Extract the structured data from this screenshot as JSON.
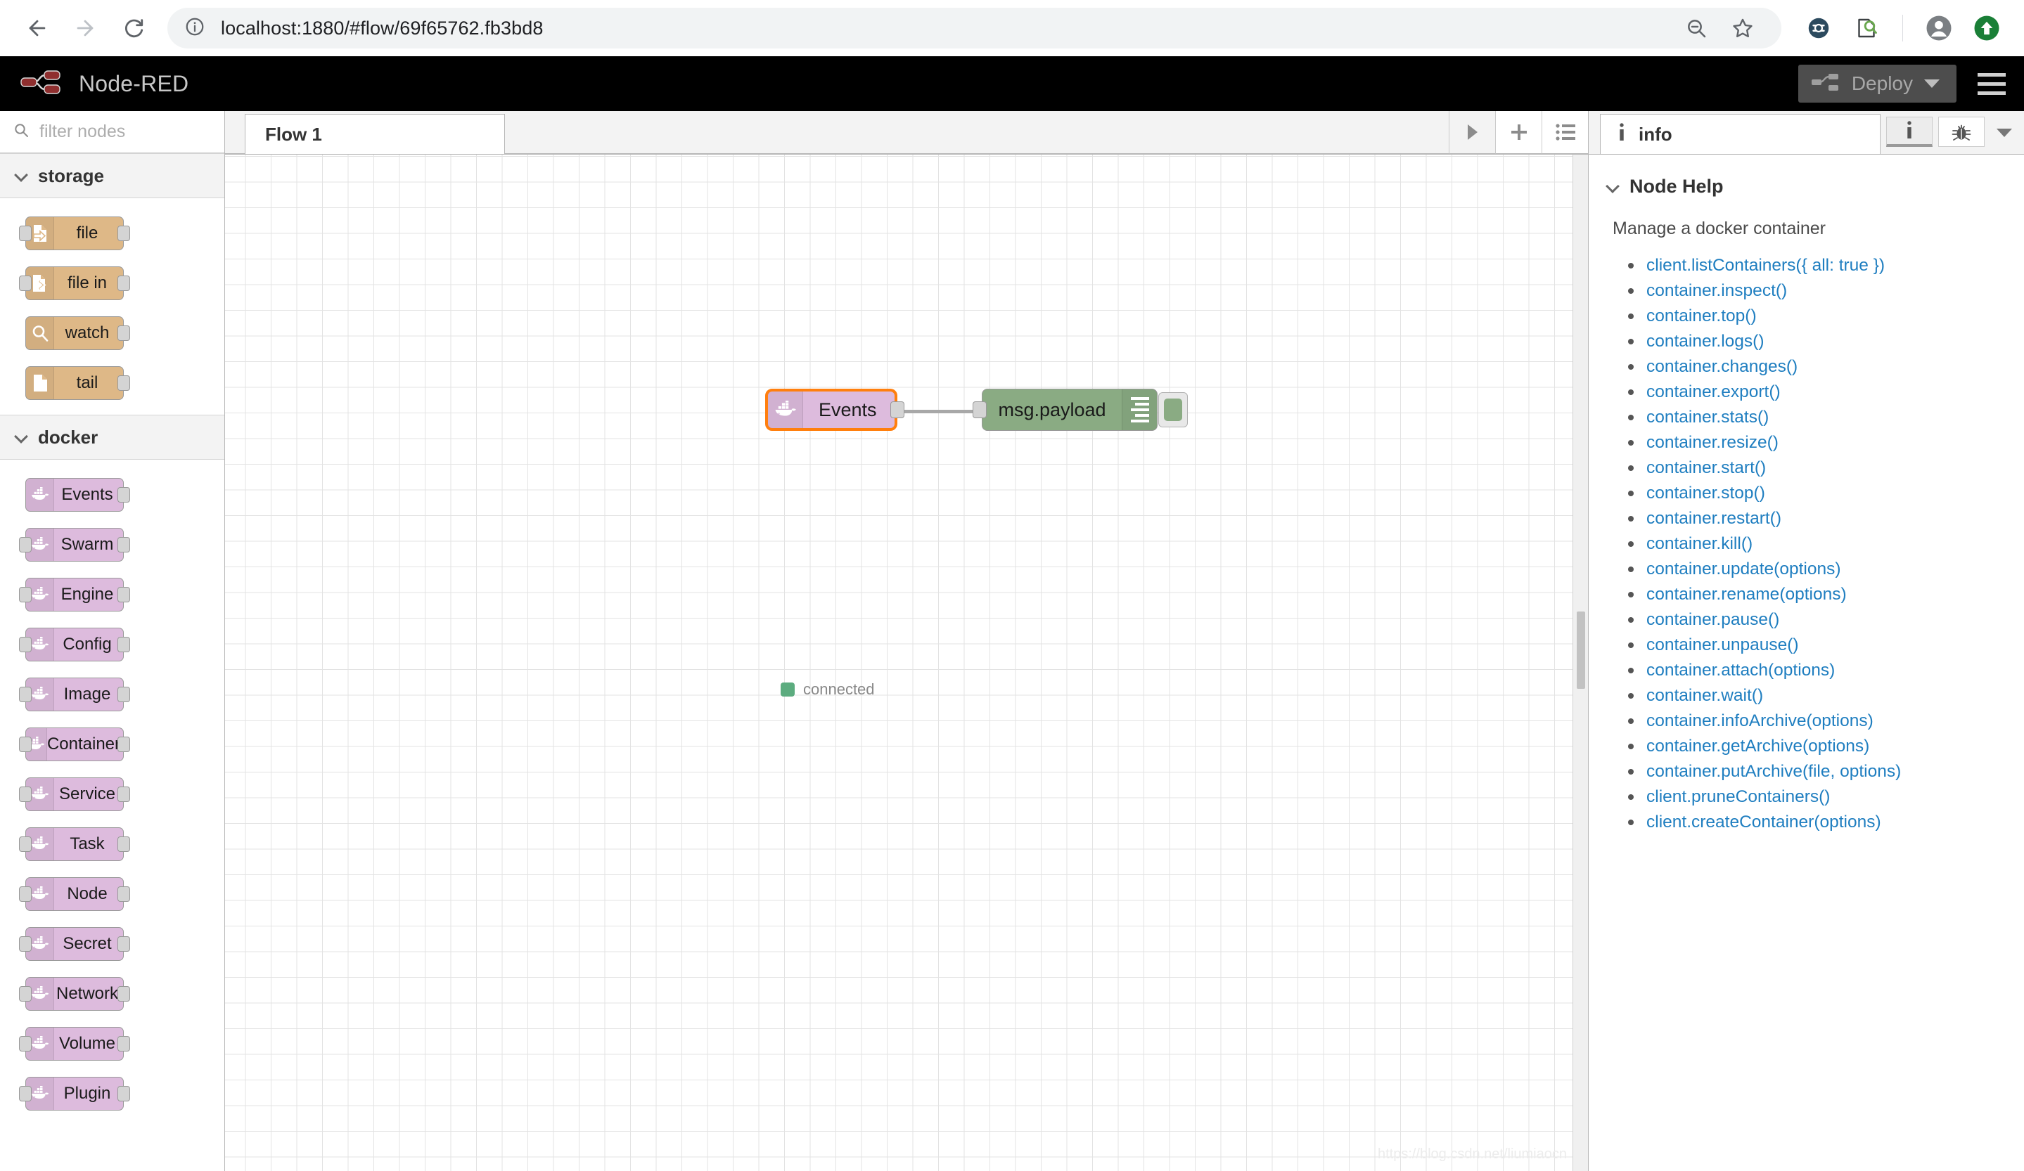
{
  "browser": {
    "url": "localhost:1880/#flow/69f65762.fb3bd8",
    "back_label": "Back",
    "forward_label": "Forward",
    "reload_label": "Reload",
    "site_info_label": "Site information",
    "zoom_out_label": "Zoom out",
    "bookmark_label": "Bookmark this tab",
    "extension1_label": "Extension",
    "extension2_label": "Extension",
    "profile_label": "Profile",
    "update_label": "Update"
  },
  "header": {
    "title": "Node-RED",
    "deploy_label": "Deploy",
    "menu_label": "Main menu"
  },
  "palette": {
    "search_placeholder": "filter nodes",
    "categories": [
      {
        "name": "storage",
        "color": "#deb887",
        "nodes": [
          {
            "label": "file",
            "icon": "file-export-icon",
            "inputs": 1,
            "outputs": 1
          },
          {
            "label": "file in",
            "icon": "file-in-icon",
            "inputs": 1,
            "outputs": 1
          },
          {
            "label": "watch",
            "icon": "magnifier-icon",
            "inputs": 0,
            "outputs": 1
          },
          {
            "label": "tail",
            "icon": "document-icon",
            "inputs": 0,
            "outputs": 1
          }
        ]
      },
      {
        "name": "docker",
        "color": "#ddbbdd",
        "nodes": [
          {
            "label": "Events",
            "icon": "docker-whale-icon",
            "inputs": 0,
            "outputs": 1
          },
          {
            "label": "Swarm",
            "icon": "docker-whale-icon",
            "inputs": 1,
            "outputs": 1
          },
          {
            "label": "Engine",
            "icon": "docker-whale-icon",
            "inputs": 1,
            "outputs": 1
          },
          {
            "label": "Config",
            "icon": "docker-whale-icon",
            "inputs": 1,
            "outputs": 1
          },
          {
            "label": "Image",
            "icon": "docker-whale-icon",
            "inputs": 1,
            "outputs": 1
          },
          {
            "label": "Container",
            "icon": "docker-whale-icon",
            "inputs": 1,
            "outputs": 1
          },
          {
            "label": "Service",
            "icon": "docker-whale-icon",
            "inputs": 1,
            "outputs": 1
          },
          {
            "label": "Task",
            "icon": "docker-whale-icon",
            "inputs": 1,
            "outputs": 1
          },
          {
            "label": "Node",
            "icon": "docker-whale-icon",
            "inputs": 1,
            "outputs": 1
          },
          {
            "label": "Secret",
            "icon": "docker-whale-icon",
            "inputs": 1,
            "outputs": 1
          },
          {
            "label": "Network",
            "icon": "docker-whale-icon",
            "inputs": 1,
            "outputs": 1
          },
          {
            "label": "Volume",
            "icon": "docker-whale-icon",
            "inputs": 1,
            "outputs": 1
          },
          {
            "label": "Plugin",
            "icon": "docker-whale-icon",
            "inputs": 1,
            "outputs": 1
          }
        ]
      }
    ]
  },
  "editor": {
    "tabs": [
      {
        "label": "Flow 1",
        "active": true
      }
    ],
    "controls": {
      "next_label": "Next flow",
      "add_label": "Add flow",
      "list_label": "List flows"
    },
    "nodes": [
      {
        "id": "events",
        "label": "Events",
        "icon": "docker-whale-icon",
        "color": "#ddbbdd",
        "selected": true,
        "status": "connected",
        "status_color": "#5cac7f"
      },
      {
        "id": "debug",
        "label": "msg.payload",
        "icon": "debug-lines-icon",
        "color": "#8aab83",
        "selected": false
      }
    ],
    "watermark": "https://blog.csdn.net/liumiaocn"
  },
  "sidebar": {
    "tab_label": "info",
    "buttons": {
      "info_label": "Information",
      "debug_label": "Debug messages",
      "more_label": "More options"
    },
    "help": {
      "section_title": "Node Help",
      "description": "Manage a docker container",
      "items": [
        "client.listContainers({ all: true })",
        "container.inspect()",
        "container.top()",
        "container.logs()",
        "container.changes()",
        "container.export()",
        "container.stats()",
        "container.resize()",
        "container.start()",
        "container.stop()",
        "container.restart()",
        "container.kill()",
        "container.update(options)",
        "container.rename(options)",
        "container.pause()",
        "container.unpause()",
        "container.attach(options)",
        "container.wait()",
        "container.infoArchive(options)",
        "container.getArchive(options)",
        "container.putArchive(file, options)",
        "client.pruneContainers()",
        "client.createContainer(options)"
      ]
    }
  }
}
